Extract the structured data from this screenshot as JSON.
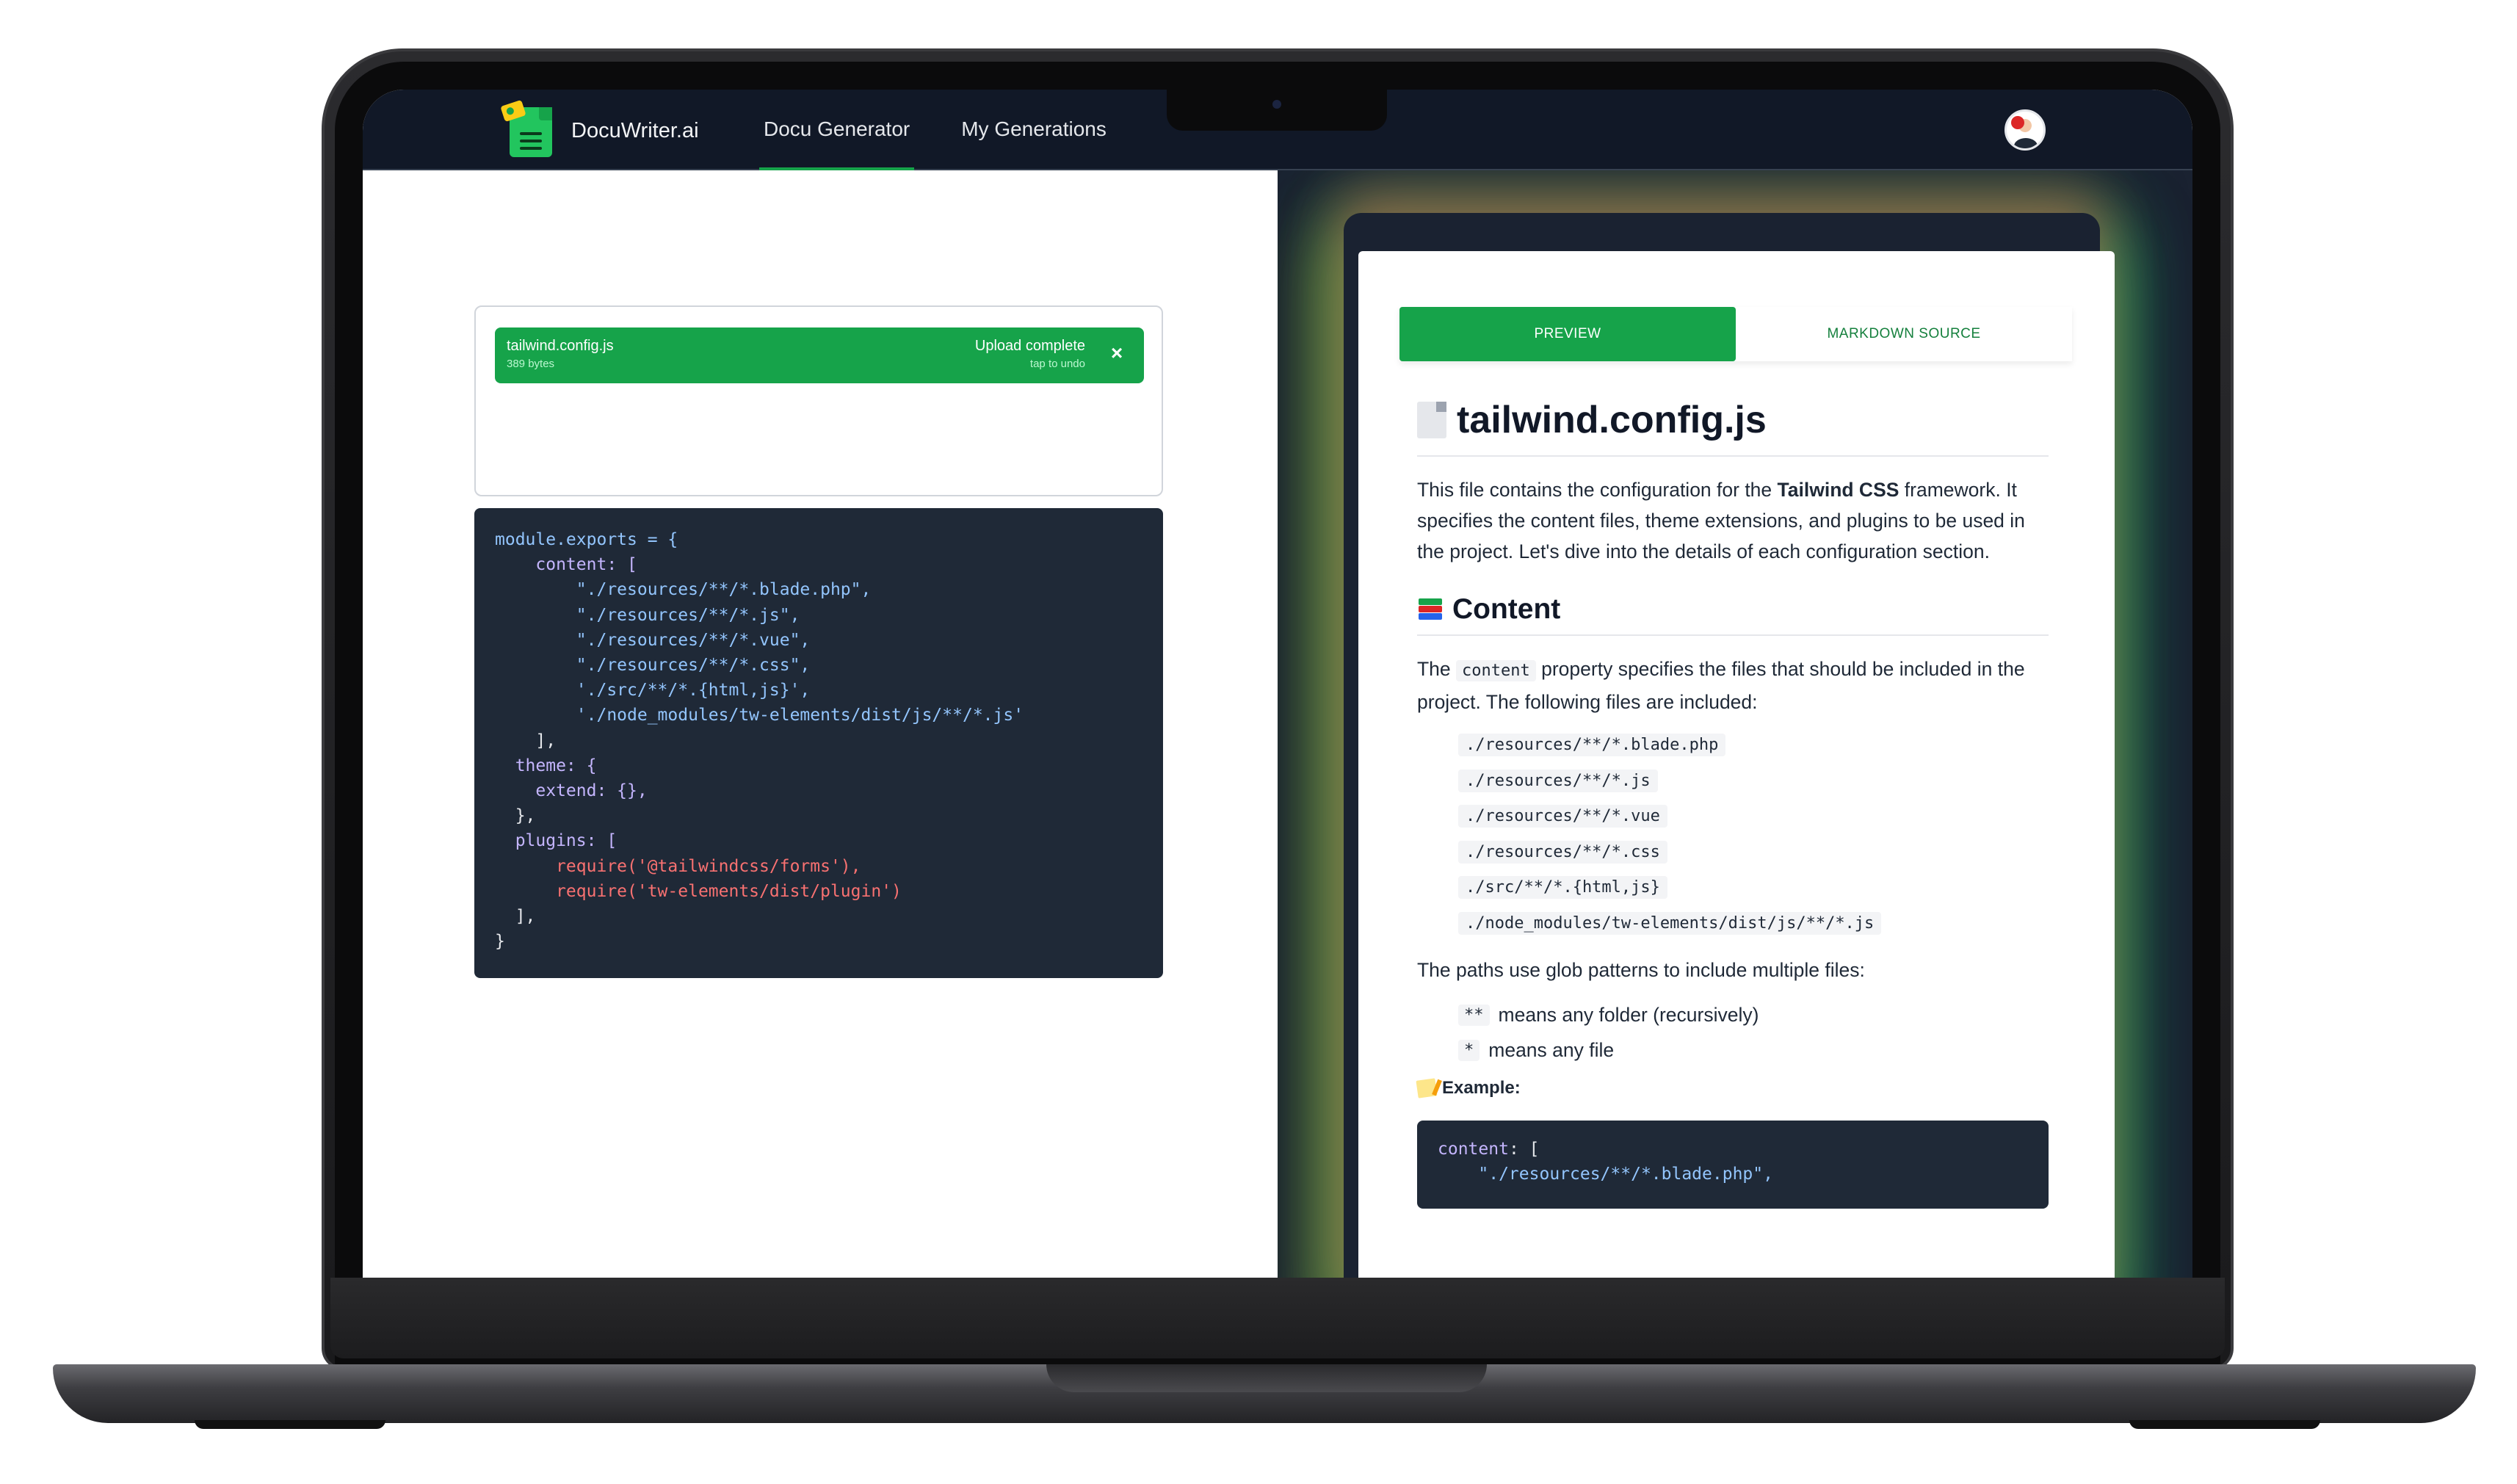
{
  "brand": {
    "name": "DocuWriter.ai"
  },
  "nav": {
    "items": [
      {
        "label": "Docu Generator",
        "active": true
      },
      {
        "label": "My Generations",
        "active": false
      }
    ]
  },
  "upload": {
    "filename": "tailwind.config.js",
    "size": "389 bytes",
    "status": "Upload complete",
    "undo": "tap to undo",
    "close": "×"
  },
  "source_code": {
    "lines": [
      [
        "module.exports = {"
      ],
      [
        "    content: ["
      ],
      [
        "        \"./resources/**/*.blade.php\","
      ],
      [
        "        \"./resources/**/*.js\","
      ],
      [
        "        \"./resources/**/*.vue\","
      ],
      [
        "        \"./resources/**/*.css\","
      ],
      [
        "        './src/**/*.{html,js}',"
      ],
      [
        "        './node_modules/tw-elements/dist/js/**/*.js'"
      ],
      [
        "    ],"
      ],
      [
        "  theme: {"
      ],
      [
        "    extend: {},"
      ],
      [
        "  },"
      ],
      [
        "  plugins: ["
      ],
      [
        "      require('@tailwindcss/forms'),"
      ],
      [
        "      require('tw-elements/dist/plugin')"
      ],
      [
        "  ],"
      ],
      [
        "}"
      ]
    ]
  },
  "preview": {
    "tabs": {
      "preview": "PREVIEW",
      "markdown": "MARKDOWN SOURCE"
    },
    "title": "tailwind.config.js",
    "intro": {
      "before": "This file contains the configuration for the ",
      "bold": "Tailwind CSS",
      "after": " framework. It specifies the content files, theme extensions, and plugins to be used in the project. Let's dive into the details of each configuration section."
    },
    "section_title": "Content",
    "content_para": {
      "before": "The ",
      "code": "content",
      "after": " property specifies the files that should be included in the project. The following files are included:"
    },
    "paths": [
      "./resources/**/*.blade.php",
      "./resources/**/*.js",
      "./resources/**/*.vue",
      "./resources/**/*.css",
      "./src/**/*.{html,js}",
      "./node_modules/tw-elements/dist/js/**/*.js"
    ],
    "glob_intro": "The paths use glob patterns to include multiple files:",
    "glob_items": [
      {
        "code": "**",
        "text": "means any folder (recursively)"
      },
      {
        "code": "*",
        "text": "means any file"
      }
    ],
    "example_label": "Example:",
    "example_code": {
      "line1_key": "content",
      "line1_rest": ": [",
      "line2": "    \"./resources/**/*.blade.php\","
    }
  }
}
